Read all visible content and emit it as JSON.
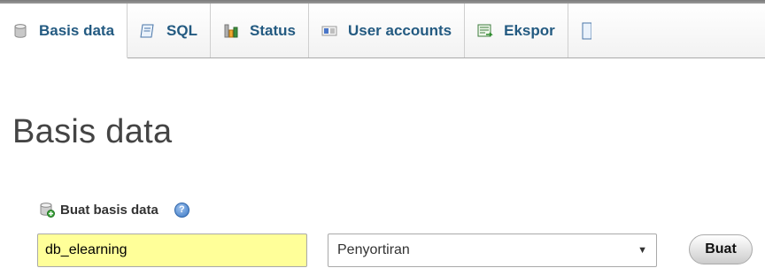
{
  "tabs": [
    {
      "label": "Basis data",
      "icon": "database-icon",
      "active": true
    },
    {
      "label": "SQL",
      "icon": "sql-icon",
      "active": false
    },
    {
      "label": "Status",
      "icon": "status-chart-icon",
      "active": false
    },
    {
      "label": "User accounts",
      "icon": "user-accounts-icon",
      "active": false
    },
    {
      "label": "Ekspor",
      "icon": "export-icon",
      "active": false
    }
  ],
  "page": {
    "title": "Basis data"
  },
  "create_db": {
    "label": "Buat basis data",
    "name_value": "db_elearning",
    "collation_selected": "Penyortiran",
    "button_label": "Buat"
  },
  "colors": {
    "tab_text": "#235a81",
    "input_highlight": "#ffff99",
    "title_text": "#444444"
  }
}
